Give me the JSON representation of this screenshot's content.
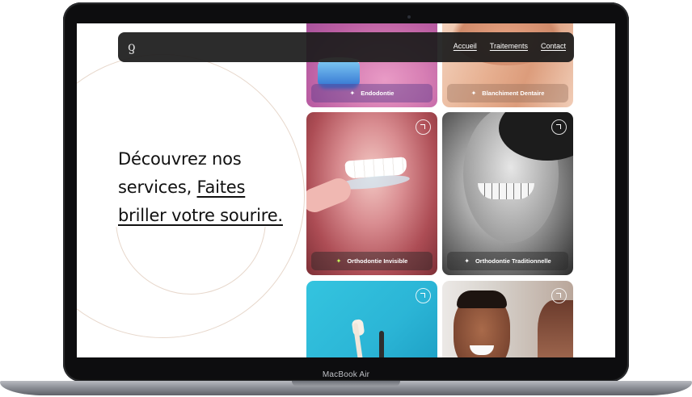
{
  "device": {
    "label": "MacBook Air"
  },
  "nav": {
    "logo": "ƍ",
    "links": [
      "Accueil",
      "Traitements",
      "Contact"
    ]
  },
  "hero": {
    "line1": "Découvrez nos",
    "line2_plain": "services, ",
    "line2_link": "Faites",
    "line3_link": "briller votre sourire."
  },
  "services": [
    {
      "label": "Endodontie"
    },
    {
      "label": "Blanchiment Dentaire"
    },
    {
      "label": "Orthodontie Invisible"
    },
    {
      "label": "Orthodontie Traditionnelle"
    }
  ],
  "colors": {
    "nav_bg": "#1c1c1c",
    "ring": "#e7d7cb",
    "accent_spark": "#c8ff5a"
  }
}
